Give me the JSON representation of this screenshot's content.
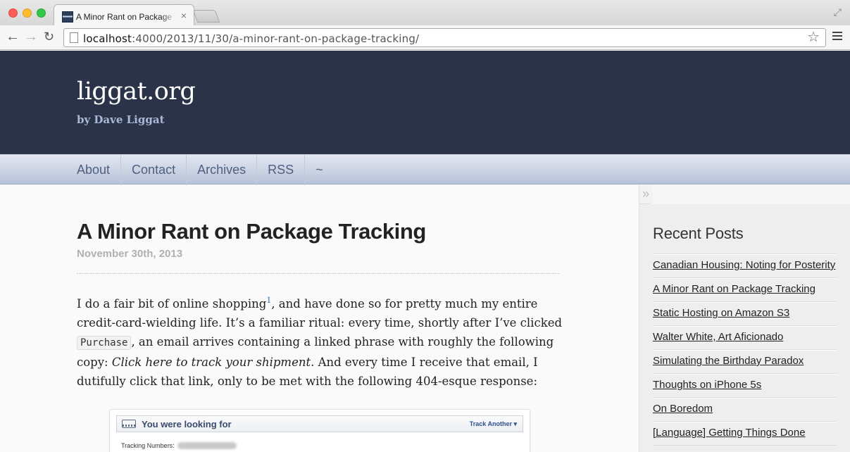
{
  "browser": {
    "tab_title": "A Minor Rant on Package Tracking",
    "tab_close": "×",
    "url_host": "localhost",
    "url_rest": ":4000/2013/11/30/a-minor-rant-on-package-tracking/",
    "back": "←",
    "forward": "→",
    "reload": "↻",
    "star": "☆",
    "fullscreen": "⤢"
  },
  "header": {
    "site_title": "liggat.org",
    "subtitle": "by Dave Liggat"
  },
  "nav": {
    "items": [
      "About",
      "Contact",
      "Archives",
      "RSS",
      "~"
    ]
  },
  "post": {
    "title": "A Minor Rant on Package Tracking",
    "date": "November 30th, 2013",
    "p1_a": "I do a fair bit of online shopping",
    "footnote": "1",
    "p1_b": ", and have done so for pretty much my entire credit-card-wielding life. It’s a familiar ritual: every time, shortly after I’ve clicked ",
    "code": "Purchase",
    "p1_c": ", an email arrives containing a linked phrase with roughly the following copy: ",
    "emphasis": "Click here to track your shipment",
    "p1_d": ". And every time I receive that email, I dutifully click that link, only to be met with the following 404-esque response:"
  },
  "figure": {
    "heading": "You were looking for",
    "action": "Track Another ▾",
    "row_label": "Tracking Numbers:"
  },
  "sidebar": {
    "collapse": "»",
    "heading": "Recent Posts",
    "posts": [
      "Canadian Housing: Noting for Posterity",
      "A Minor Rant on Package Tracking",
      "Static Hosting on Amazon S3",
      "Walter White, Art Aficionado",
      "Simulating the Birthday Paradox",
      "Thoughts on iPhone 5s",
      "On Boredom",
      "[Language] Getting Things Done"
    ]
  },
  "colors": {
    "header_bg": "#2a3348",
    "nav_text": "#4f5f80",
    "link_blue": "#3a6bb5"
  }
}
